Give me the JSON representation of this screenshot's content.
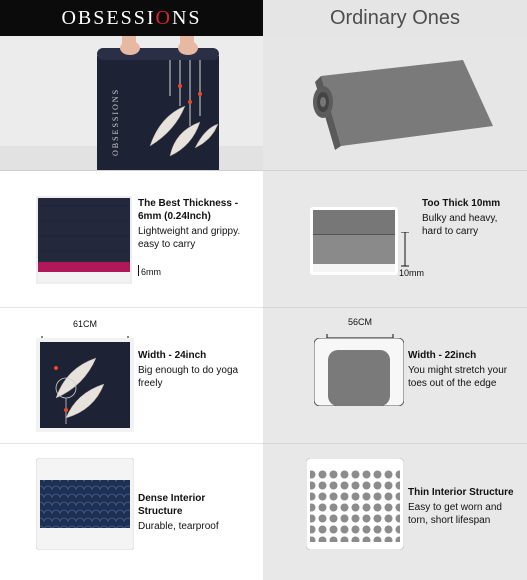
{
  "header": {
    "brand_prefix": "OBSESSI",
    "brand_accent": "O",
    "brand_suffix": "NS",
    "competitor": "Ordinary Ones"
  },
  "hero": {
    "mat_vertical_text": "OBSESSIONS"
  },
  "rows": [
    {
      "left_title": "The Best Thickness - 6mm (0.24Inch)",
      "left_desc": "Lightweight and grippy. easy to carry",
      "left_measure": "6mm",
      "right_title": "Too Thick 10mm",
      "right_desc": "Bulky and heavy, hard to carry",
      "right_measure": "10mm"
    },
    {
      "left_title": "Width - 24inch",
      "left_desc": "Big enough to do yoga freely",
      "left_measure": "61CM",
      "right_title": "Width - 22inch",
      "right_desc": "You might stretch your toes out of the edge",
      "right_measure": "56CM"
    },
    {
      "left_title": "Dense Interior Structure",
      "left_desc": "Durable, tearproof",
      "right_title": "Thin Interior Structure",
      "right_desc": "Easy to get worn and torn, short lifespan"
    }
  ],
  "colors": {
    "header_dark": "#0b0b0b",
    "accent_red": "#d8242f",
    "mat_navy": "#1e2235",
    "mat_magenta": "#b0185a",
    "ordinary_gray": "#6b6b6b"
  }
}
